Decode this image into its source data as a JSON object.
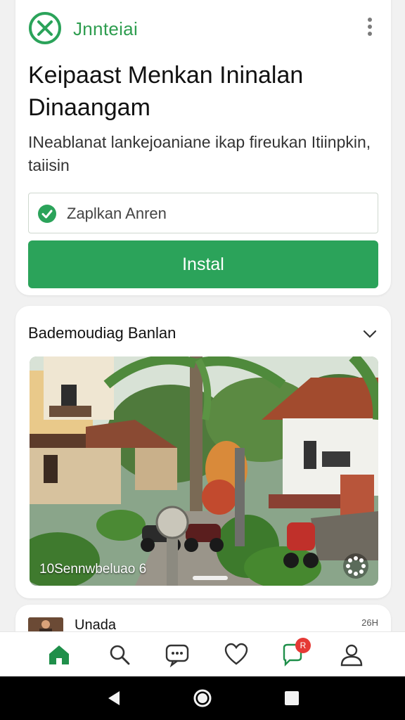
{
  "app": {
    "name": "Jnnteiai",
    "title": "Keipaast Menkan Ininalan Dinaangam",
    "subtitle": "INeablanat lankejoaniane ikap fireukan Itiinpkin, taiisin",
    "field_value": "Zaplkan Anren",
    "install_label": "Instal",
    "accent_color": "#2ba35a",
    "logo_icon": "circle-x-logo"
  },
  "gallery": {
    "title": "Bademoudiag Banlan",
    "photo_caption": "10Sennwbeluao 6"
  },
  "review": {
    "reviewer_name": "Unada",
    "date": "26H"
  },
  "bottom_nav": {
    "items": [
      {
        "icon": "home-icon",
        "active": true
      },
      {
        "icon": "search-icon",
        "active": false
      },
      {
        "icon": "chat-icon",
        "active": false
      },
      {
        "icon": "heart-icon",
        "active": false
      },
      {
        "icon": "notification-icon",
        "active": false,
        "badge": "R"
      },
      {
        "icon": "profile-icon",
        "active": false
      }
    ]
  },
  "system_nav": [
    "back-icon",
    "home-circle-icon",
    "recents-icon"
  ]
}
